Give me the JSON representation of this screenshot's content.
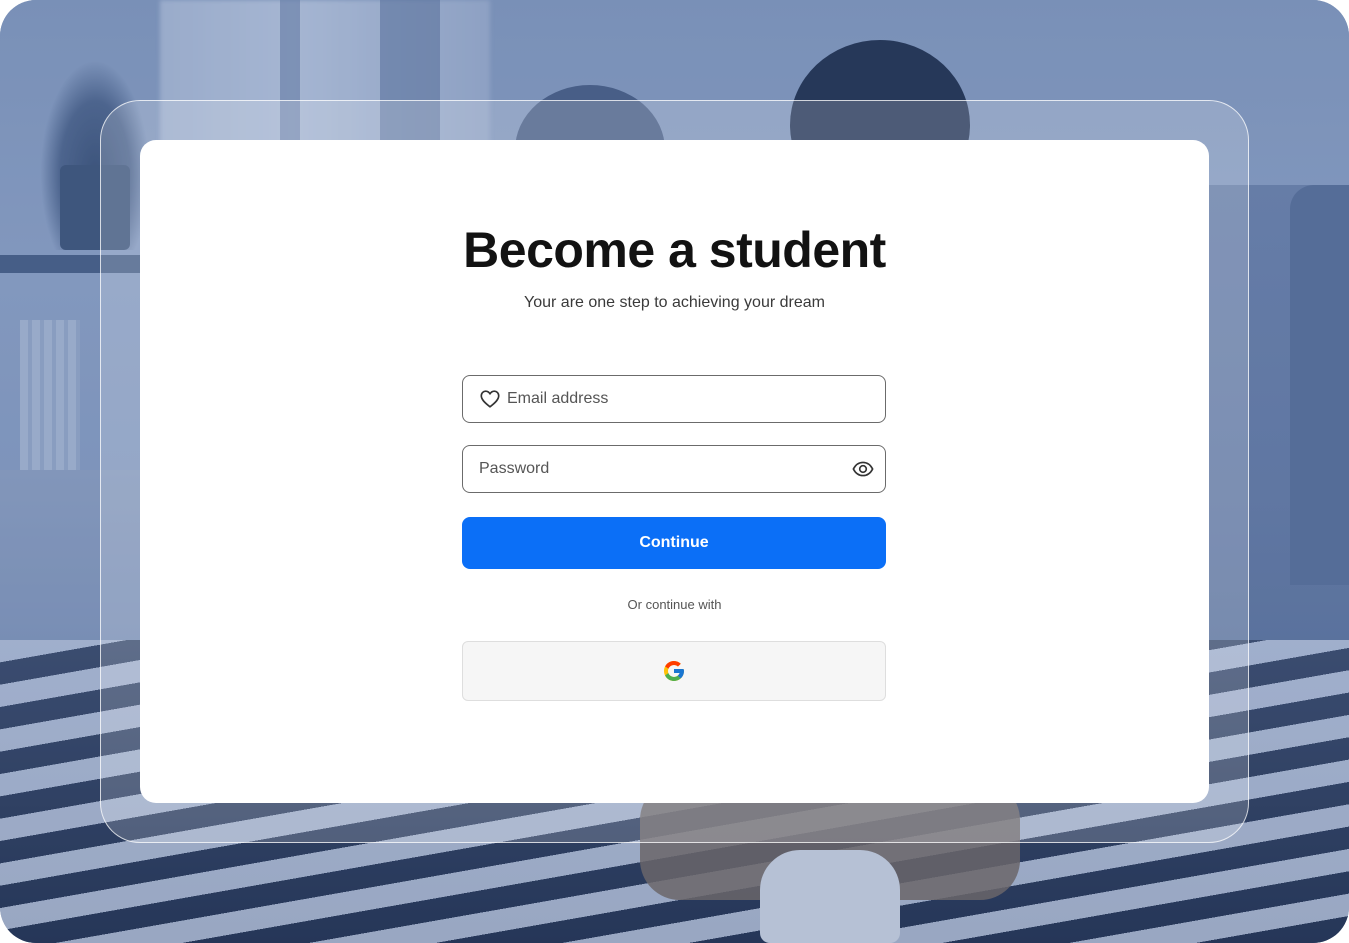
{
  "page": {
    "title": "Become a student",
    "subtitle": "Your are one step to achieving your dream"
  },
  "form": {
    "email": {
      "placeholder": "Email address",
      "value": "",
      "icon": "heart-icon"
    },
    "password": {
      "placeholder": "Password",
      "value": "",
      "icon": "eye-icon"
    },
    "continue_label": "Continue",
    "divider_text": "Or continue with",
    "social": {
      "provider": "google",
      "icon": "google-icon"
    }
  },
  "colors": {
    "accent": "#0b6ff7",
    "card_background": "#ffffff",
    "title": "#121212"
  }
}
